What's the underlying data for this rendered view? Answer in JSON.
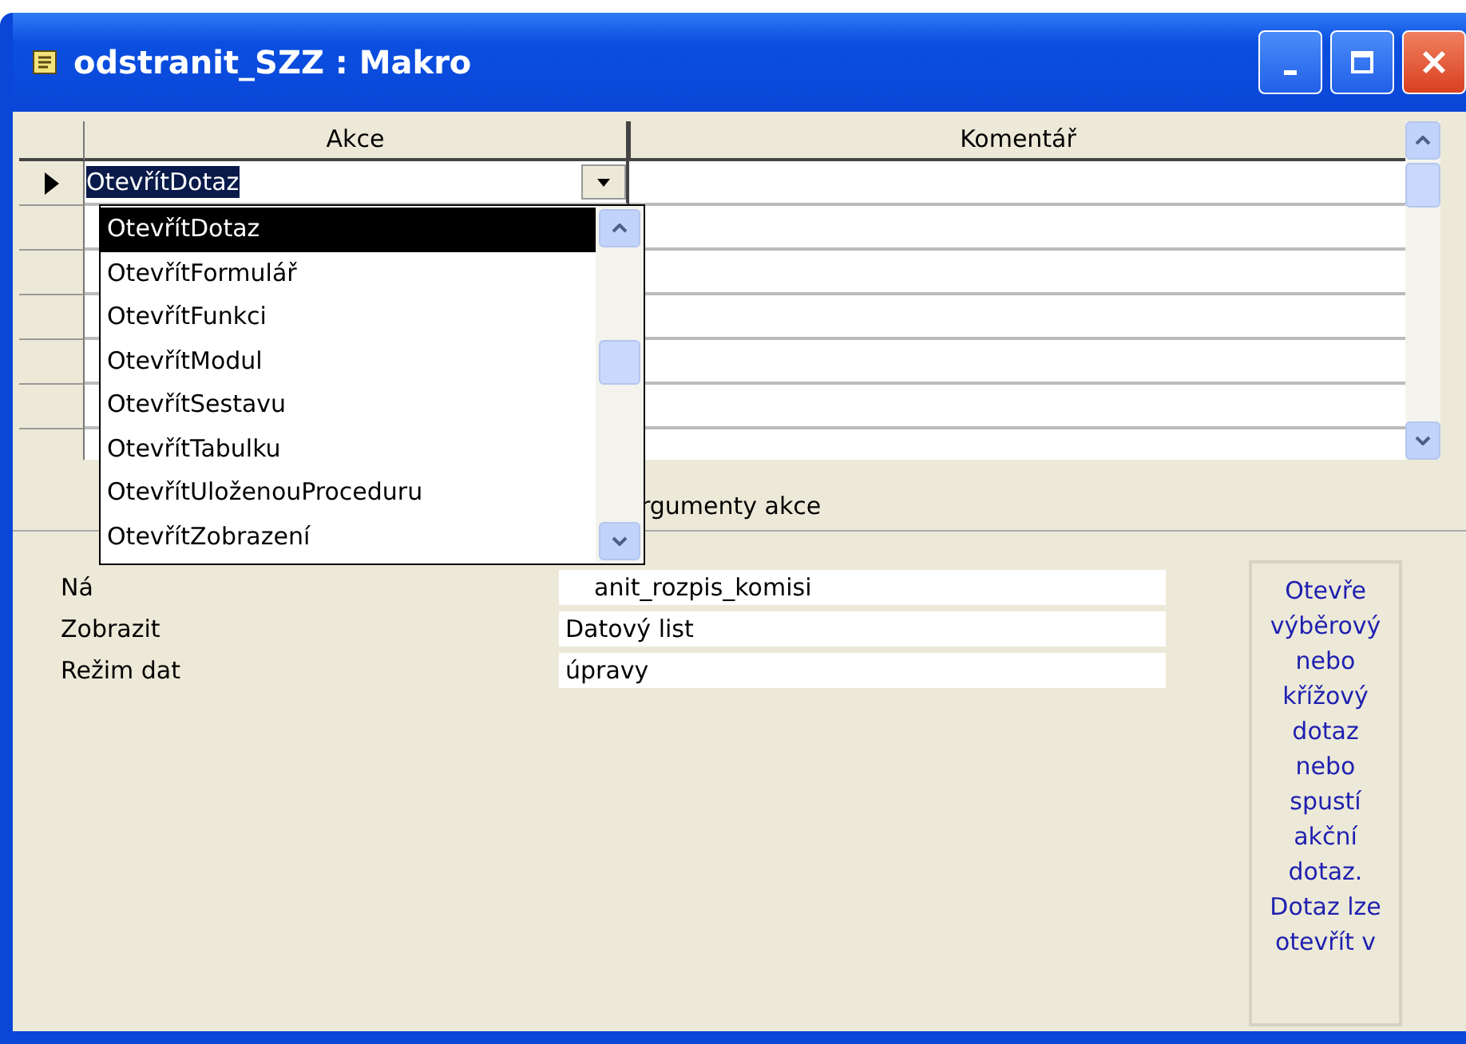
{
  "window": {
    "title": "odstranit_SZZ : Makro"
  },
  "grid": {
    "columns": [
      {
        "label": "Akce"
      },
      {
        "label": "Komentář"
      }
    ],
    "current_action": "OtevřítDotaz"
  },
  "dropdown": {
    "items": [
      {
        "label": "OtevřítDotaz",
        "selected": true
      },
      {
        "label": "OtevřítFormulář",
        "selected": false
      },
      {
        "label": "OtevřítFunkci",
        "selected": false
      },
      {
        "label": "OtevřítModul",
        "selected": false
      },
      {
        "label": "OtevřítSestavu",
        "selected": false
      },
      {
        "label": "OtevřítTabulku",
        "selected": false
      },
      {
        "label": "OtevřítUloženouProceduru",
        "selected": false
      },
      {
        "label": "OtevřítZobrazení",
        "selected": false
      }
    ]
  },
  "arguments": {
    "heading": "rgumenty akce",
    "fields": [
      {
        "label": "Ná",
        "value": "anit_rozpis_komisi"
      },
      {
        "label": "Zobrazit",
        "value": "Datový list"
      },
      {
        "label": "Režim dat",
        "value": "úpravy"
      }
    ],
    "help_text": "Otevře výběrový nebo křížový dotaz nebo spustí akční dotaz. Dotaz lze otevřít v"
  }
}
